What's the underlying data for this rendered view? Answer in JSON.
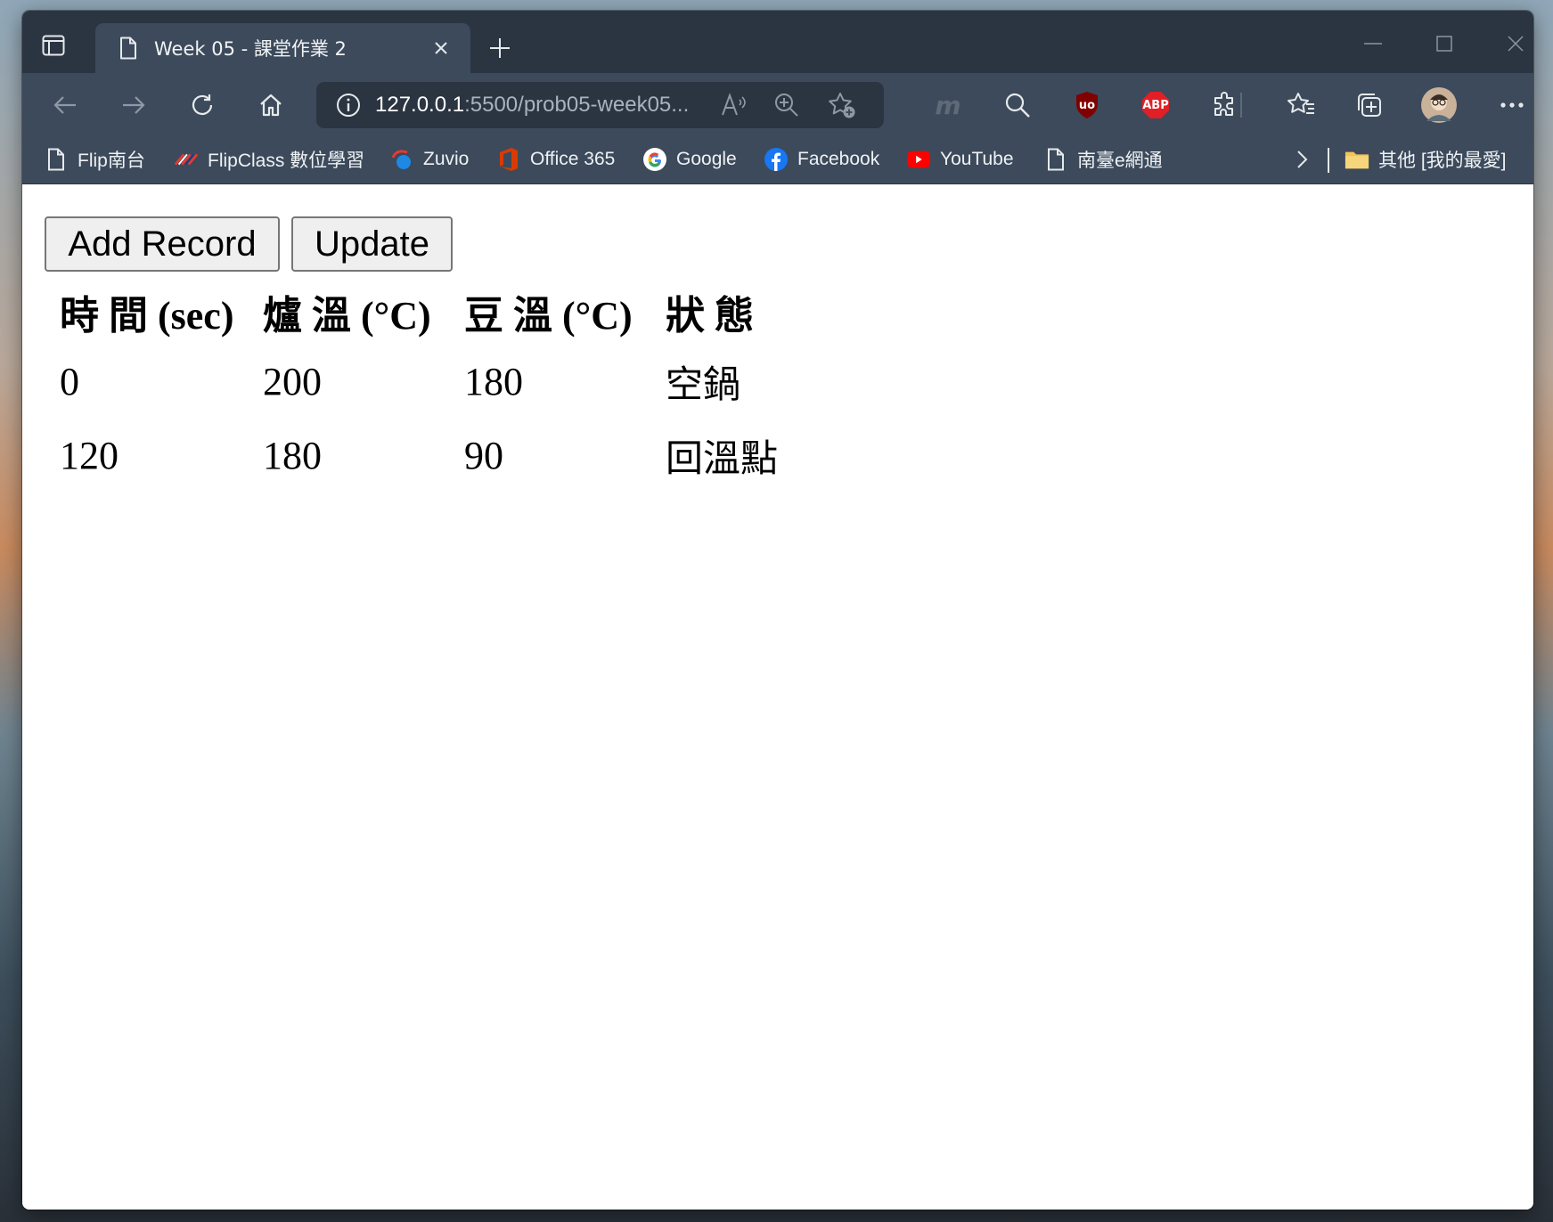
{
  "browser": {
    "tab_title": "Week 05 - 課堂作業 2",
    "address": {
      "host": "127.0.0.1",
      "path": ":5500/prob05-week05..."
    },
    "bookmarks": [
      {
        "label": "Flip南台"
      },
      {
        "label": "FlipClass 數位學習"
      },
      {
        "label": "Zuvio"
      },
      {
        "label": "Office 365"
      },
      {
        "label": "Google"
      },
      {
        "label": "Facebook"
      },
      {
        "label": "YouTube"
      },
      {
        "label": "南臺e網通"
      }
    ],
    "other_favorites": "其他 [我的最愛]",
    "extension_m_label": "m",
    "ublock_label": "uo",
    "abp_label": "ABP"
  },
  "page": {
    "add_button": "Add Record",
    "update_button": "Update",
    "table": {
      "headers": [
        "時 間 (sec)",
        "爐 溫 (°C)",
        "豆 溫 (°C)",
        "狀 態"
      ],
      "rows": [
        [
          "0",
          "200",
          "180",
          "空鍋"
        ],
        [
          "120",
          "180",
          "90",
          "回溫點"
        ]
      ]
    }
  },
  "colors": {
    "tab_bar": "#2b3441",
    "toolbar": "#3c4a5b",
    "ublock_red": "#800000",
    "abp_red": "#e01f26",
    "youtube_red": "#ff0000",
    "facebook_blue": "#1877f2",
    "office_red": "#d83b01",
    "folder_yellow": "#f3c454"
  }
}
